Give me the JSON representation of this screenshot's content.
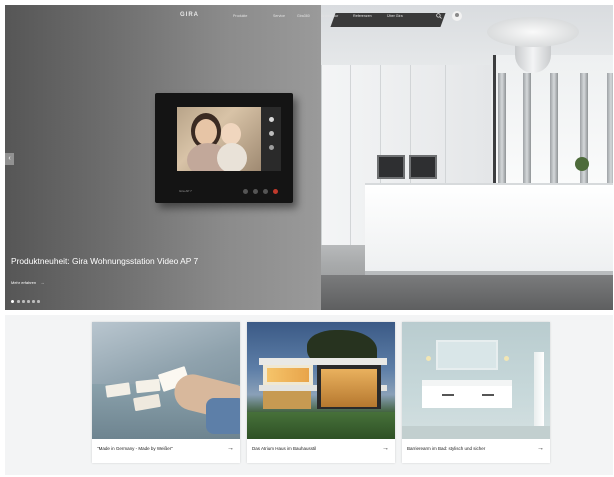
{
  "nav": {
    "logo": "GIRA",
    "items": [
      "Produkte",
      "Service",
      "Gira360",
      "Architektur",
      "Referenzen",
      "Über Gira"
    ]
  },
  "device": {
    "caption": "Gira AP 7"
  },
  "hero": {
    "title": "Produktneuheit: Gira Wohnungsstation Video AP 7",
    "link": "Mehr erfahren",
    "link_arrow": "→",
    "prev_arrow": "‹",
    "slide_count": 6,
    "active_slide": 1
  },
  "cards": [
    {
      "caption": "\"Made in Germany - Made by Weißer\"",
      "arrow": "→"
    },
    {
      "caption": "Das Atrium Haus im Bauhausstil",
      "arrow": "→"
    },
    {
      "caption": "Barrierearm im Bad: stylisch und sicher",
      "arrow": "→"
    }
  ],
  "colors": {
    "hero_text": "#ffffff",
    "card_background": "#ffffff",
    "band_background": "#f3f4f5",
    "device_body": "#141414"
  },
  "icons": {
    "search": "search-icon",
    "user": "user-icon",
    "arrow": "arrow-right-icon",
    "prev": "chevron-left-icon"
  }
}
